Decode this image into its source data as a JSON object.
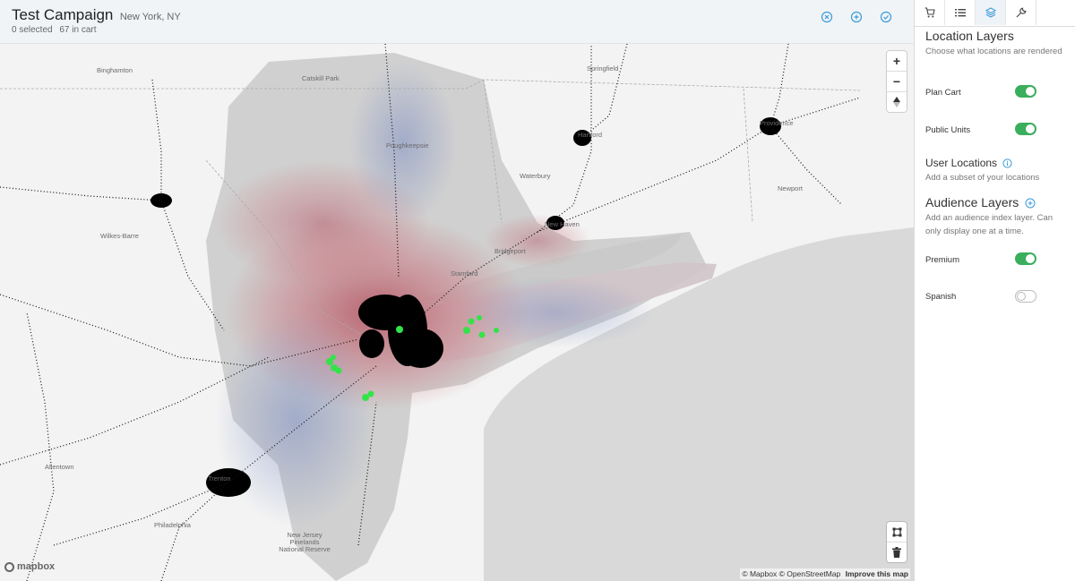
{
  "header": {
    "campaign_name": "Test Campaign",
    "location": "New York, NY",
    "selected_text": "0 selected",
    "cart_text": "67 in cart",
    "icons": [
      "close-circle-icon",
      "plus-circle-icon",
      "check-circle-icon"
    ],
    "accent_color": "#3b9ad9"
  },
  "map": {
    "place_labels": [
      "Binghamton",
      "Catskill Park",
      "Springfield",
      "Hartford",
      "Providence",
      "Poughkeepsie",
      "Waterbury",
      "New Haven",
      "Newport",
      "Wilkes-Barre",
      "Bridgeport",
      "Stamford",
      "Trenton",
      "Allentown",
      "Philadelphia",
      "New Jersey Pinelands National Reserve"
    ],
    "zoom_in": "+",
    "zoom_out": "−",
    "compass": "▲",
    "logo": "mapbox",
    "attribution_1": "© Mapbox",
    "attribution_2": "© OpenStreetMap",
    "attribution_link": "Improve this map",
    "cart_marker_color": "#34e34a"
  },
  "panel": {
    "tabs": [
      "cart-icon",
      "list-icon",
      "layers-icon",
      "wrench-icon"
    ],
    "active_tab": "layers-icon",
    "location_layers": {
      "title": "Location Layers",
      "desc": "Choose what locations are rendered",
      "items": [
        {
          "label": "Plan Cart",
          "enabled": true
        },
        {
          "label": "Public Units",
          "enabled": true
        }
      ]
    },
    "user_locations": {
      "title": "User Locations",
      "desc": "Add a subset of your locations"
    },
    "audience_layers": {
      "title": "Audience Layers",
      "desc": "Add an audience index layer. Can only display one at a time.",
      "items": [
        {
          "label": "Premium",
          "enabled": true
        },
        {
          "label": "Spanish",
          "enabled": false
        }
      ]
    },
    "toggle_on_color": "#3aae5c"
  }
}
